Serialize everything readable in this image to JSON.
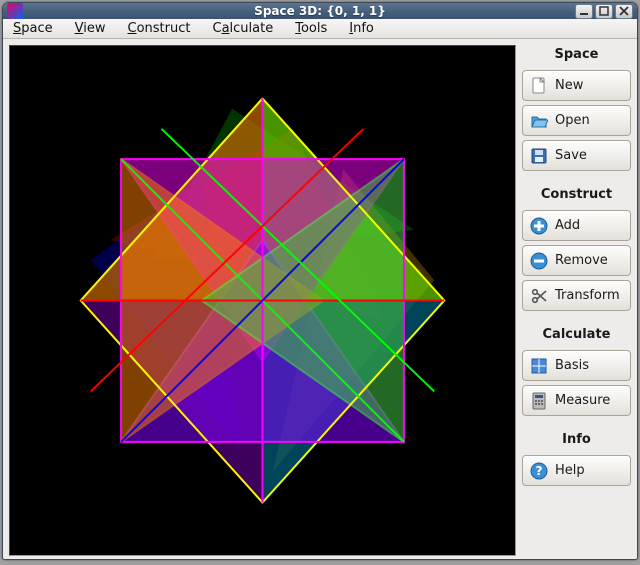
{
  "window": {
    "title": "Space 3D: {0, 1, 1}"
  },
  "menubar": {
    "items": [
      {
        "label": "Space",
        "accel": "S"
      },
      {
        "label": "View",
        "accel": "V"
      },
      {
        "label": "Construct",
        "accel": "C"
      },
      {
        "label": "Calculate",
        "accel": "a"
      },
      {
        "label": "Tools",
        "accel": "T"
      },
      {
        "label": "Info",
        "accel": "I"
      }
    ]
  },
  "sidebar": {
    "groups": [
      {
        "title": "Space",
        "items": [
          {
            "label": "New",
            "icon": "new-file-icon"
          },
          {
            "label": "Open",
            "icon": "open-folder-icon"
          },
          {
            "label": "Save",
            "icon": "save-disk-icon"
          }
        ]
      },
      {
        "title": "Construct",
        "items": [
          {
            "label": "Add",
            "icon": "add-plus-icon"
          },
          {
            "label": "Remove",
            "icon": "remove-minus-icon"
          },
          {
            "label": "Transform",
            "icon": "scissors-icon"
          }
        ]
      },
      {
        "title": "Calculate",
        "items": [
          {
            "label": "Basis",
            "icon": "grid-icon"
          },
          {
            "label": "Measure",
            "icon": "calculator-icon"
          }
        ]
      },
      {
        "title": "Info",
        "items": [
          {
            "label": "Help",
            "icon": "help-question-icon"
          }
        ]
      }
    ]
  },
  "viewport": {
    "description": "3D compound polyhedron (intersecting octahedra) rendered as translucent colored facets",
    "background": "#000000",
    "edge_colors": [
      "#ff0000",
      "#00ff00",
      "#0000ff",
      "#ffff00",
      "#ff00ff",
      "#00ffff"
    ],
    "face_colors": [
      "#ff0000",
      "#00c000",
      "#0000ff",
      "#ffff00",
      "#ff00ff",
      "#ff8000",
      "#8000ff"
    ]
  }
}
